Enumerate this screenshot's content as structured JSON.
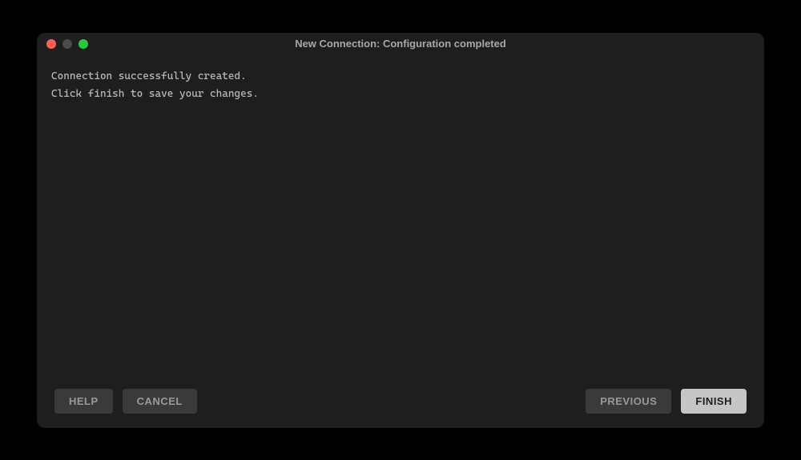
{
  "window": {
    "title": "New Connection: Configuration completed"
  },
  "content": {
    "line1": "Connection successfully created.",
    "line2": "Click finish to save your changes."
  },
  "footer": {
    "help_label": "HELP",
    "cancel_label": "CANCEL",
    "previous_label": "PREVIOUS",
    "finish_label": "FINISH"
  }
}
